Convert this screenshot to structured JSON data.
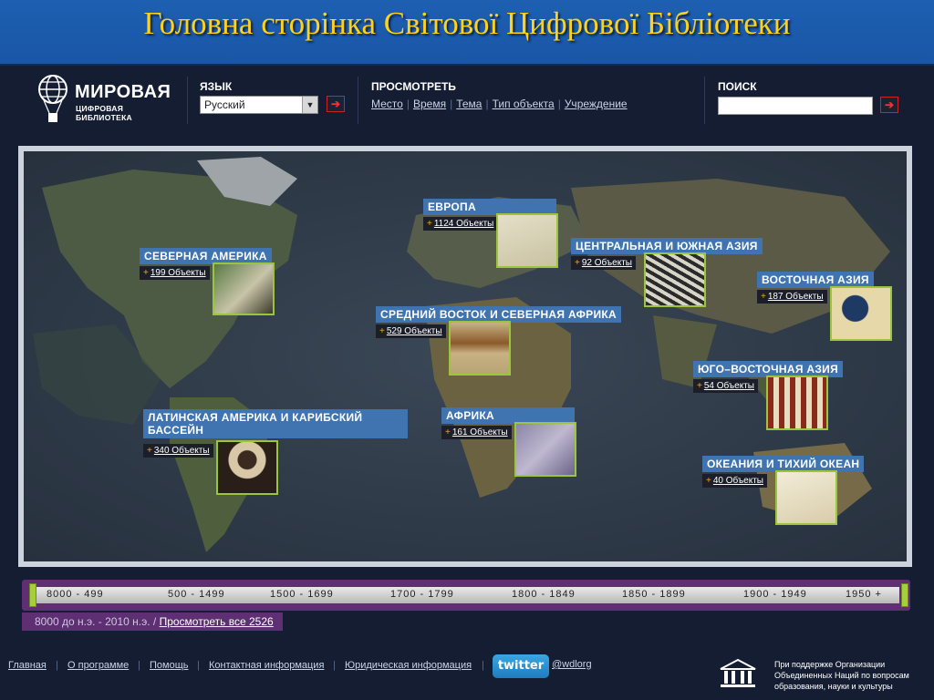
{
  "slide": {
    "title": "Головна сторінка Світової Цифрової Бібліотеки"
  },
  "header": {
    "logo_title": "МИРОВАЯ",
    "logo_subtitle": "ЦИФРОВАЯ БИБЛИОТЕКА",
    "language_label": "ЯЗЫК",
    "language_value": "Русский",
    "browse_label": "ПРОСМОТРЕТЬ",
    "browse_links": [
      "Место",
      "Время",
      "Тема",
      "Тип объекта",
      "Учреждение"
    ],
    "search_label": "ПОИСК",
    "search_value": ""
  },
  "regions": [
    {
      "name": "СЕВЕРНАЯ АМЕРИКА",
      "count": "199 Объекты"
    },
    {
      "name": "ЕВРОПА",
      "count": "1124 Объекты"
    },
    {
      "name": "ЦЕНТРАЛЬНАЯ И ЮЖНАЯ АЗИЯ",
      "count": "92 Объекты"
    },
    {
      "name": "ВОСТОЧНАЯ АЗИЯ",
      "count": "187 Объекты"
    },
    {
      "name": "СРЕДНИЙ ВОСТОК И СЕВЕРНАЯ АФРИКА",
      "count": "529 Объекты"
    },
    {
      "name": "ЮГО–ВОСТОЧНАЯ АЗИЯ",
      "count": "54 Объекты"
    },
    {
      "name": "ЛАТИНСКАЯ АМЕРИКА И КАРИБСКИЙ",
      "name2": "БАССЕЙН",
      "count": "340 Объекты"
    },
    {
      "name": "АФРИКА",
      "count": "161 Объекты"
    },
    {
      "name": "ОКЕАНИЯ И ТИХИЙ ОКЕАН",
      "count": "40 Объекты"
    }
  ],
  "timeline": {
    "periods": [
      "8000 - 499",
      "500 - 1499",
      "1500 - 1699",
      "1700 - 1799",
      "1800 - 1849",
      "1850 - 1899",
      "1900 - 1949",
      "1950 +"
    ],
    "range_text": "8000 до н.э. - 2010 н.э. / ",
    "view_all": "Просмотреть все 2526"
  },
  "footer": {
    "links": [
      "Главная",
      "О программе",
      "Помощь",
      "Контактная информация",
      "Юридическая информация"
    ],
    "twitter": "twitter",
    "twitter_handle": "@wdlorg",
    "unesco_text": [
      "При поддержке Организации",
      "Объединенных Наций по вопросам",
      "образования, науки и культуры"
    ]
  },
  "colors": {
    "title_yellow": "#ffd21a",
    "region_blue": "#3f74b0",
    "thumb_border": "#9bc53d",
    "timeline_purple": "#5e2f73"
  }
}
